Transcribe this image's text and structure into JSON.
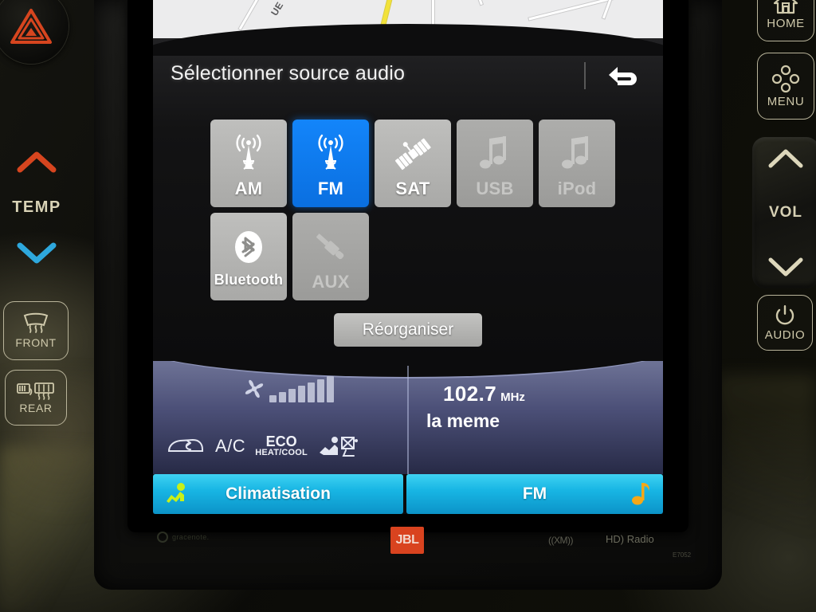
{
  "screen": {
    "title": "Sélectionner source audio",
    "back_icon": "back-arrow-icon",
    "sources_row1": [
      {
        "label": "AM",
        "icon": "radio-tower-icon",
        "state": "enabled"
      },
      {
        "label": "FM",
        "icon": "radio-tower-icon",
        "state": "active"
      },
      {
        "label": "SAT",
        "icon": "satellite-icon",
        "state": "enabled"
      },
      {
        "label": "USB",
        "icon": "music-note-icon",
        "state": "disabled"
      },
      {
        "label": "iPod",
        "icon": "music-note-icon",
        "state": "disabled"
      }
    ],
    "sources_row2": [
      {
        "label": "Bluetooth",
        "icon": "bluetooth-icon",
        "state": "enabled"
      },
      {
        "label": "AUX",
        "icon": "aux-plug-icon",
        "state": "disabled"
      }
    ],
    "reorganize_label": "Réorganiser",
    "climate": {
      "fan_icon": "fan-icon",
      "fan_level": 7,
      "fan_max": 7,
      "recirculation_icon": "air-recirculation-icon",
      "ac_label": "A/C",
      "eco_line1": "ECO",
      "eco_line2": "HEAT/COOL",
      "seat_icon": "seat-airflow-icon",
      "seat_off_icon": "seat-disabled-icon"
    },
    "radio": {
      "frequency": "102.7",
      "unit": "MHz",
      "station": "la meme"
    },
    "tabs": [
      {
        "label": "Climatisation",
        "icon": "airflow-person-icon",
        "accent": "#c8f018"
      },
      {
        "label": "FM",
        "icon": "music-note-icon",
        "accent": "#f5a818"
      }
    ],
    "map": {
      "street_label": "UE"
    }
  },
  "branding": {
    "gracenote": "gracenote.",
    "jbl": "JBL",
    "xm": "((XM))",
    "hd_radio": "HD) Radio",
    "model_code": "E7052"
  },
  "hardware": {
    "home_label": "HOME",
    "menu_label": "MENU",
    "vol_label": "VOL",
    "audio_label": "AUDIO",
    "temp_label": "TEMP",
    "front_label": "FRONT",
    "rear_label": "REAR",
    "hazard_icon": "hazard-triangle-icon"
  },
  "colors": {
    "accent_blue": "#1385fa",
    "tab_cyan": "#18b6e4",
    "jbl_red": "#d9431f",
    "temp_hot": "#d6451f",
    "temp_cold": "#2ea8dd"
  }
}
